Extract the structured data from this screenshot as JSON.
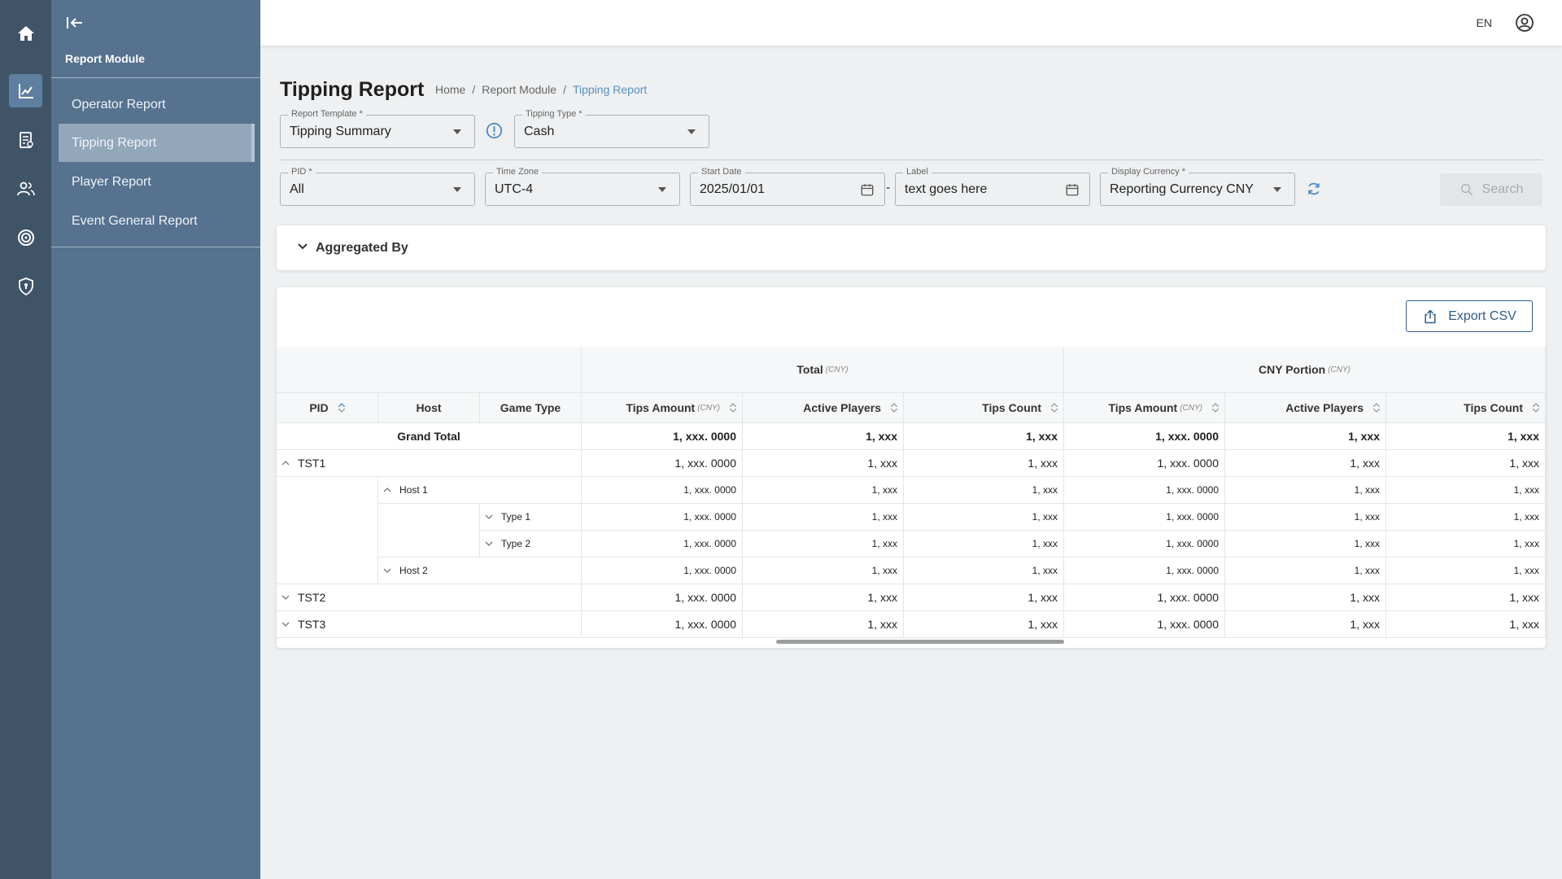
{
  "rail": {
    "icons": [
      "home-icon",
      "chart-icon",
      "report-icon",
      "users-icon",
      "target-icon",
      "shield-icon"
    ]
  },
  "sidebar": {
    "title": "Report Module",
    "items": [
      {
        "label": "Operator Report"
      },
      {
        "label": "Tipping Report"
      },
      {
        "label": "Player Report"
      },
      {
        "label": "Event General Report"
      }
    ]
  },
  "header": {
    "lang": "EN"
  },
  "page": {
    "title": "Tipping Report",
    "breadcrumb": [
      "Home",
      "/",
      "Report Module",
      "/",
      "Tipping Report"
    ]
  },
  "filters": {
    "report_template": {
      "label": "Report Template *",
      "value": "Tipping Summary"
    },
    "tipping_type": {
      "label": "Tipping Type *",
      "value": "Cash"
    },
    "pid": {
      "label": "PID *",
      "value": "All"
    },
    "time_zone": {
      "label": "Time Zone",
      "value": "UTC-4"
    },
    "start_date": {
      "label": "Start Date",
      "value": "2025/01/01"
    },
    "dash": "-",
    "end_label": {
      "label": "Label",
      "value": "text goes here"
    },
    "display_currency": {
      "label": "Display Currency *",
      "value": "Reporting Currency CNY"
    },
    "search_label": "Search"
  },
  "aggregated": {
    "label": "Aggregated By"
  },
  "table": {
    "export_label": "Export CSV",
    "group_total": "Total",
    "group_cny": "CNY Portion",
    "unit": "(CNY)",
    "columns": {
      "pid": "PID",
      "host": "Host",
      "game_type": "Game Type",
      "tips_amount": "Tips Amount",
      "active_players": "Active Players",
      "tips_count": "Tips Count"
    },
    "grand_total": "Grand Total",
    "rows": {
      "grand": {
        "v": [
          "1, xxx. 0000",
          "1, xxx",
          "1, xxx",
          "1, xxx. 0000",
          "1, xxx",
          "1, xxx"
        ]
      },
      "tst1": {
        "label": "TST1",
        "v": [
          "1, xxx. 0000",
          "1, xxx",
          "1, xxx",
          "1, xxx. 0000",
          "1, xxx",
          "1, xxx"
        ]
      },
      "host1": {
        "label": "Host 1",
        "v": [
          "1, xxx. 0000",
          "1, xxx",
          "1, xxx",
          "1, xxx. 0000",
          "1, xxx",
          "1, xxx"
        ]
      },
      "type1": {
        "label": "Type 1",
        "v": [
          "1, xxx. 0000",
          "1, xxx",
          "1, xxx",
          "1, xxx. 0000",
          "1, xxx",
          "1, xxx"
        ]
      },
      "type2": {
        "label": "Type 2",
        "v": [
          "1, xxx. 0000",
          "1, xxx",
          "1, xxx",
          "1, xxx. 0000",
          "1, xxx",
          "1, xxx"
        ]
      },
      "host2": {
        "label": "Host 2",
        "v": [
          "1, xxx. 0000",
          "1, xxx",
          "1, xxx",
          "1, xxx. 0000",
          "1, xxx",
          "1, xxx"
        ]
      },
      "tst2": {
        "label": "TST2",
        "v": [
          "1, xxx. 0000",
          "1, xxx",
          "1, xxx",
          "1, xxx. 0000",
          "1, xxx",
          "1, xxx"
        ]
      },
      "tst3": {
        "label": "TST3",
        "v": [
          "1, xxx. 0000",
          "1, xxx",
          "1, xxx",
          "1, xxx. 0000",
          "1, xxx",
          "1, xxx"
        ]
      }
    }
  },
  "colors": {
    "rail_bg": "#405468",
    "sidebar_bg": "#56728f",
    "accent": "#5b8fc0",
    "export_border": "#2f5d87"
  }
}
